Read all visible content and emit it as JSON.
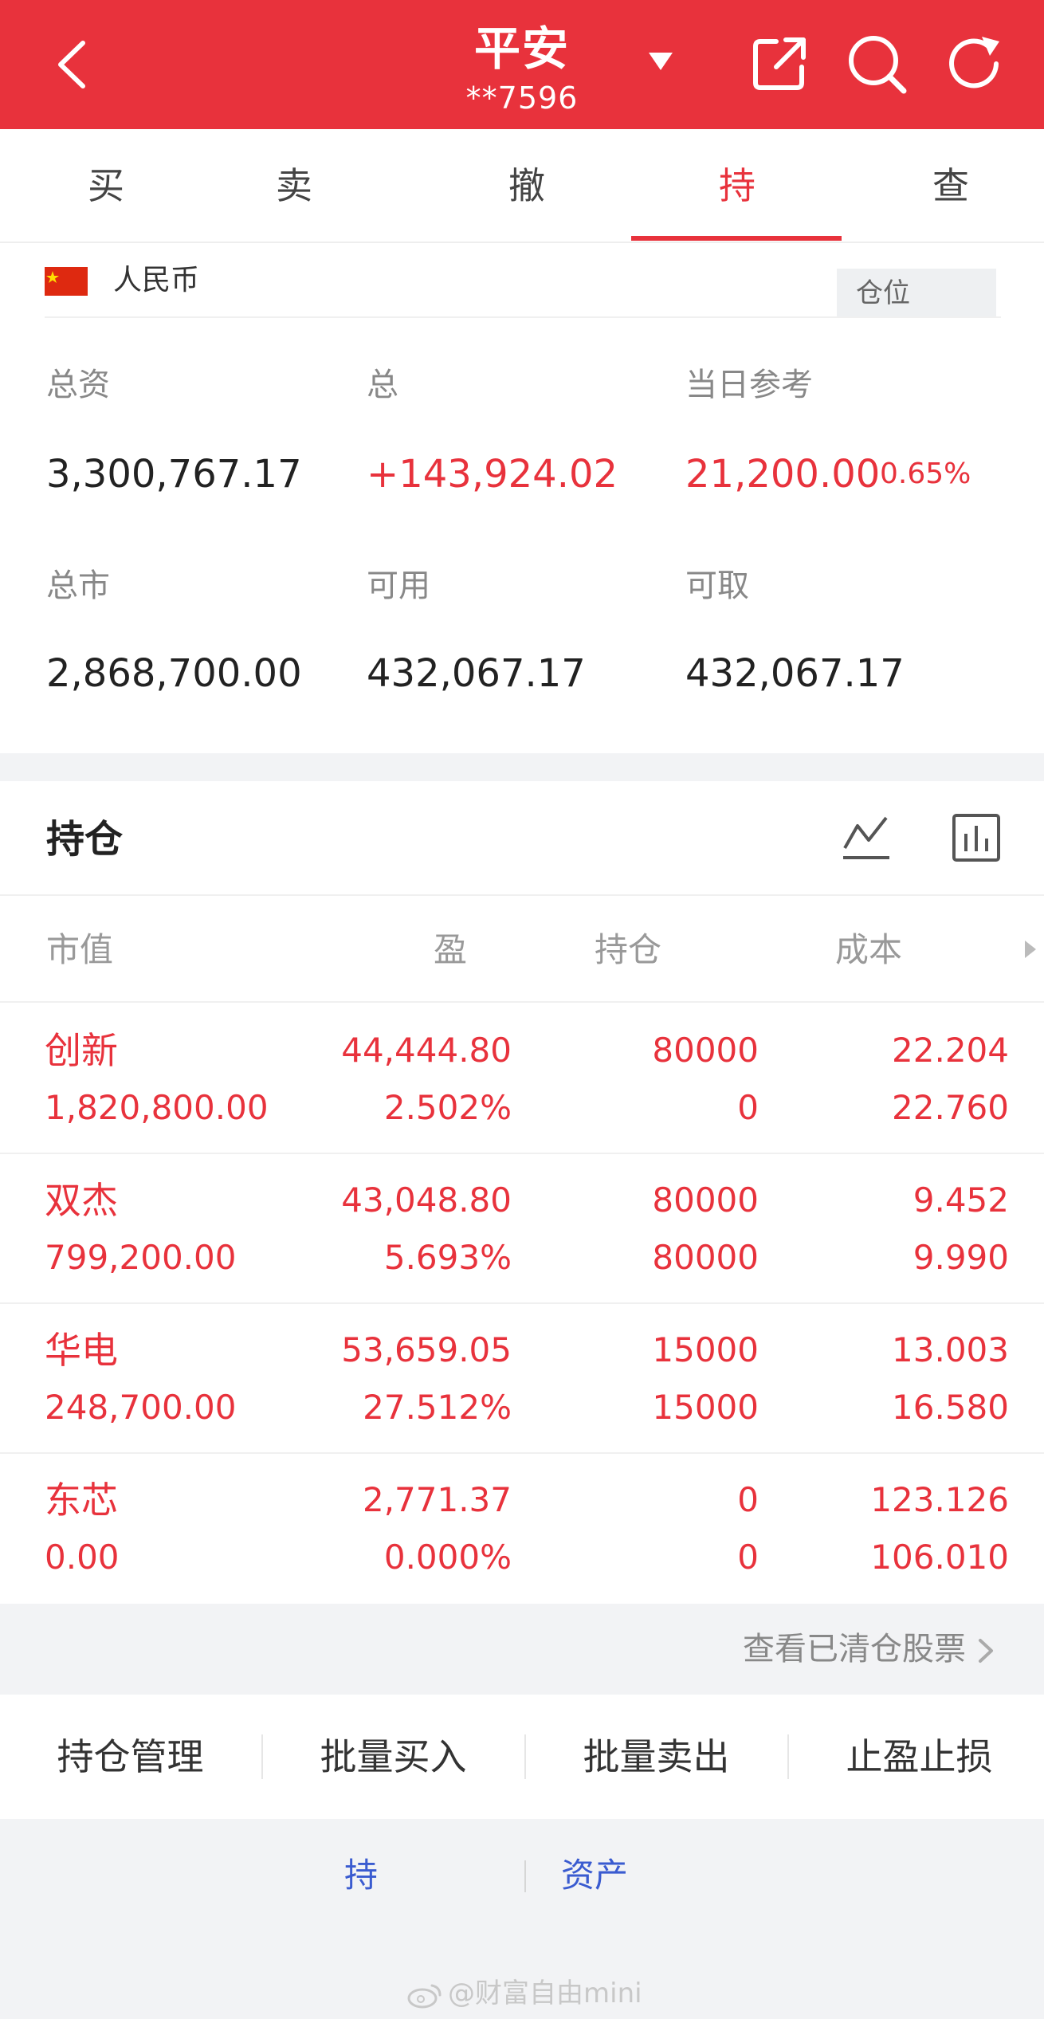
{
  "header": {
    "title": "平安",
    "account": "**7596",
    "colors": {
      "header_bg": "#e8323c",
      "accent": "#e8323c",
      "link": "#3a5bd0"
    }
  },
  "tabs": [
    {
      "label": "买",
      "active": false
    },
    {
      "label": "卖",
      "active": false
    },
    {
      "label": "撤",
      "active": false
    },
    {
      "label": "持",
      "active": true
    },
    {
      "label": "查",
      "active": false
    }
  ],
  "summary": {
    "currency": "人民币",
    "position_button": "仓位",
    "stats": [
      {
        "label": "总资",
        "value": "3,300,767.17",
        "tone": "normal"
      },
      {
        "label": "总",
        "value": "+143,924.02",
        "tone": "red"
      },
      {
        "label": "当日参考",
        "value": "21,200.00",
        "tone": "red",
        "pct": "0.65%"
      },
      {
        "label": "总市",
        "value": "2,868,700.00",
        "tone": "normal"
      },
      {
        "label": "可用",
        "value": "432,067.17",
        "tone": "normal"
      },
      {
        "label": "可取",
        "value": "432,067.17",
        "tone": "normal"
      }
    ]
  },
  "holdings": {
    "title": "持仓",
    "columns": [
      "市值",
      "盈",
      "持仓",
      "成本"
    ],
    "rows": [
      {
        "name": "创新",
        "market_value": "1,820,800.00",
        "pnl": "44,444.80",
        "pnl_pct": "2.502%",
        "position": "80000",
        "available": "0",
        "cost": "22.204",
        "price": "22.760"
      },
      {
        "name": "双杰",
        "market_value": "799,200.00",
        "pnl": "43,048.80",
        "pnl_pct": "5.693%",
        "position": "80000",
        "available": "80000",
        "cost": "9.452",
        "price": "9.990"
      },
      {
        "name": "华电",
        "market_value": "248,700.00",
        "pnl": "53,659.05",
        "pnl_pct": "27.512%",
        "position": "15000",
        "available": "15000",
        "cost": "13.003",
        "price": "16.580"
      },
      {
        "name": "东芯",
        "market_value": "0.00",
        "pnl": "2,771.37",
        "pnl_pct": "0.000%",
        "position": "0",
        "available": "0",
        "cost": "123.126",
        "price": "106.010"
      }
    ]
  },
  "cleared_link": "查看已清仓股票",
  "actions": [
    "持仓管理",
    "批量买入",
    "批量卖出",
    "止盈止损"
  ],
  "bottom_links": [
    "持",
    "资产"
  ],
  "watermark": "@财富自由mini"
}
